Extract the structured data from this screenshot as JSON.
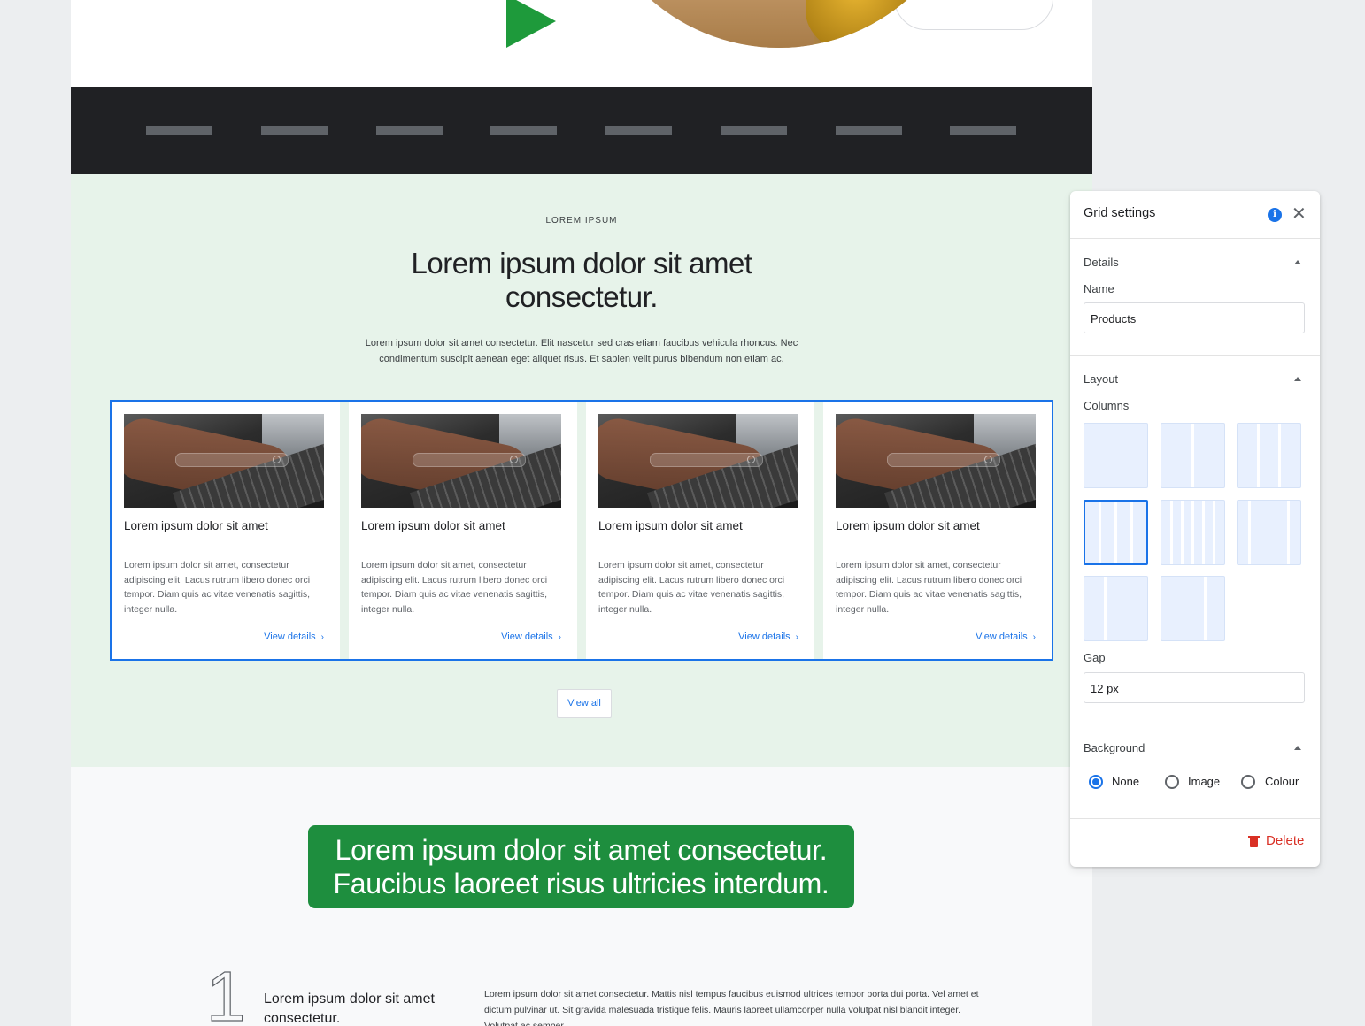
{
  "hero": {
    "play_icon": "play-triangle-icon",
    "colors": {
      "accent": "#1e9a3b"
    }
  },
  "logo_bar": {
    "placeholders": 8,
    "colors": {
      "background": "#202124",
      "placeholder": "#5f6368"
    }
  },
  "products": {
    "eyebrow": "LOREM IPSUM",
    "headline": "Lorem ipsum dolor sit amet consectetur.",
    "lede": "Lorem ipsum dolor sit amet consectetur. Elit nascetur sed cras etiam faucibus vehicula rhoncus. Nec condimentum suscipit aenean eget aliquet risus. Et sapien velit purus bibendum non etiam ac.",
    "cards": [
      {
        "title": "Lorem ipsum dolor sit amet",
        "description": "Lorem ipsum dolor sit amet, consectetur adipiscing elit. Lacus rutrum libero donec orci tempor. Diam quis ac vitae venenatis sagittis, integer nulla.",
        "link": "View details"
      },
      {
        "title": "Lorem ipsum dolor sit amet",
        "description": "Lorem ipsum dolor sit amet, consectetur adipiscing elit. Lacus rutrum libero donec orci tempor. Diam quis ac vitae venenatis sagittis, integer nulla.",
        "link": "View details"
      },
      {
        "title": "Lorem ipsum dolor sit amet",
        "description": "Lorem ipsum dolor sit amet, consectetur adipiscing elit. Lacus rutrum libero donec orci tempor. Diam quis ac vitae venenatis sagittis, integer nulla.",
        "link": "View details"
      },
      {
        "title": "Lorem ipsum dolor sit amet",
        "description": "Lorem ipsum dolor sit amet, consectetur adipiscing elit. Lacus rutrum libero donec orci tempor. Diam quis ac vitae venenatis sagittis, integer nulla.",
        "link": "View details"
      }
    ],
    "view_all": "View all",
    "colors": {
      "background": "#e7f3ea",
      "selection": "#1a73e8",
      "link": "#1a73e8"
    }
  },
  "lower": {
    "banner": "Lorem ipsum dolor sit amet consectetur. Faucibus laoreet risus ultricies interdum.",
    "step_number": "1",
    "step_title": "Lorem ipsum dolor sit amet consectetur.",
    "step_text": "Lorem ipsum dolor sit amet consectetur. Mattis nisl tempus faucibus euismod ultrices tempor porta dui porta. Vel amet et dictum pulvinar ut. Sit gravida malesuada tristique felis. Mauris laoreet ullamcorper nulla volutpat nisl blandit integer. Volutpat ac semper.",
    "colors": {
      "banner": "#1e8e3e"
    }
  },
  "panel": {
    "title": "Grid settings",
    "info_icon": "info-icon",
    "close_icon": "close-icon",
    "details": {
      "label": "Details",
      "name_label": "Name",
      "name_value": "Products"
    },
    "layout": {
      "label": "Layout",
      "columns_label": "Columns",
      "column_options": [
        "1 column",
        "2 columns",
        "3 columns",
        "4 columns",
        "6 columns",
        "3 columns wide centre",
        "2 columns narrow left",
        "2 columns narrow right"
      ],
      "selected_option": "4 columns",
      "gap_label": "Gap",
      "gap_value": "12 px"
    },
    "background": {
      "label": "Background",
      "options": [
        "None",
        "Image",
        "Colour"
      ],
      "selected": "None"
    },
    "delete_label": "Delete",
    "delete_icon": "trash-icon",
    "colors": {
      "accent": "#1a73e8",
      "danger": "#d93025",
      "option_fill": "#e8f0fe"
    }
  }
}
